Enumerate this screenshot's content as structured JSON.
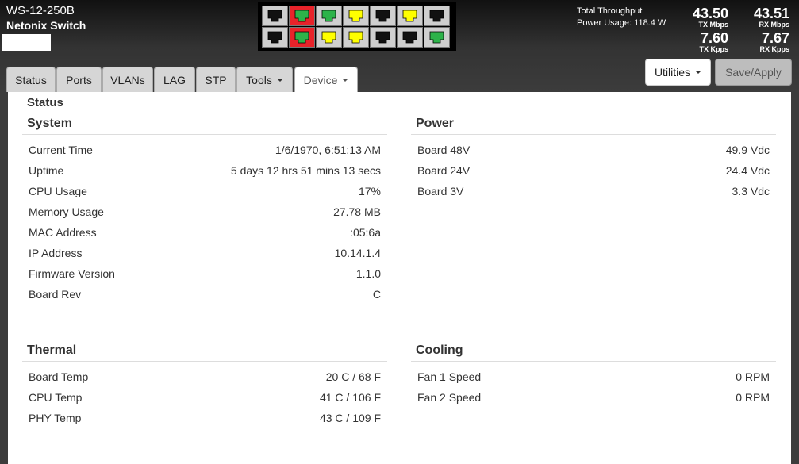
{
  "header": {
    "model": "WS-12-250B",
    "device_name": "Netonix Switch",
    "throughput_label": "Total Throughput",
    "power_usage": "Power Usage: 118.4 W",
    "tx_mbps": "43.50",
    "tx_mbps_label": "TX Mbps",
    "rx_mbps": "43.51",
    "rx_mbps_label": "RX Mbps",
    "tx_kpps": "7.60",
    "tx_kpps_label": "TX Kpps",
    "rx_kpps": "7.67",
    "rx_kpps_label": "RX Kpps"
  },
  "ports": {
    "top": [
      "black",
      "green",
      "green",
      "yellow",
      "black",
      "yellow",
      "black"
    ],
    "bottom": [
      "black",
      "green",
      "yellow",
      "yellow",
      "black",
      "black",
      "green"
    ],
    "top_border": [
      "gray",
      "red",
      "gray",
      "gray",
      "gray",
      "gray",
      "gray"
    ],
    "bottom_border": [
      "gray",
      "red",
      "gray",
      "gray",
      "gray",
      "gray",
      "gray"
    ],
    "colors": {
      "green": "#2db34a",
      "yellow": "#ffff00",
      "black": "#111111",
      "red": "#e8232a"
    }
  },
  "tabs": [
    {
      "label": "Status"
    },
    {
      "label": "Ports"
    },
    {
      "label": "VLANs"
    },
    {
      "label": "LAG"
    },
    {
      "label": "STP"
    },
    {
      "label": "Tools"
    },
    {
      "label": "Device"
    }
  ],
  "buttons": {
    "utilities": "Utilities",
    "save_apply": "Save/Apply"
  },
  "page_title": "Status",
  "system": {
    "title": "System",
    "rows": [
      {
        "label": "Current Time",
        "value": "1/6/1970, 6:51:13 AM"
      },
      {
        "label": "Uptime",
        "value": "5 days 12 hrs 51 mins 13 secs"
      },
      {
        "label": "CPU Usage",
        "value": "17%"
      },
      {
        "label": "Memory Usage",
        "value": "27.78 MB"
      },
      {
        "label": "MAC Address",
        "value": ":05:6a"
      },
      {
        "label": "IP Address",
        "value": "10.14.1.4"
      },
      {
        "label": "Firmware Version",
        "value": "1.1.0"
      },
      {
        "label": "Board Rev",
        "value": "C"
      }
    ]
  },
  "power": {
    "title": "Power",
    "rows": [
      {
        "label": "Board 48V",
        "value": "49.9 Vdc"
      },
      {
        "label": "Board 24V",
        "value": "24.4 Vdc"
      },
      {
        "label": "Board 3V",
        "value": "3.3 Vdc"
      }
    ]
  },
  "thermal": {
    "title": "Thermal",
    "rows": [
      {
        "label": "Board Temp",
        "value": "20 C / 68 F"
      },
      {
        "label": "CPU Temp",
        "value": "41 C / 106 F"
      },
      {
        "label": "PHY Temp",
        "value": "43 C / 109 F"
      }
    ]
  },
  "cooling": {
    "title": "Cooling",
    "rows": [
      {
        "label": "Fan 1 Speed",
        "value": "0 RPM"
      },
      {
        "label": "Fan 2 Speed",
        "value": "0 RPM"
      }
    ]
  }
}
